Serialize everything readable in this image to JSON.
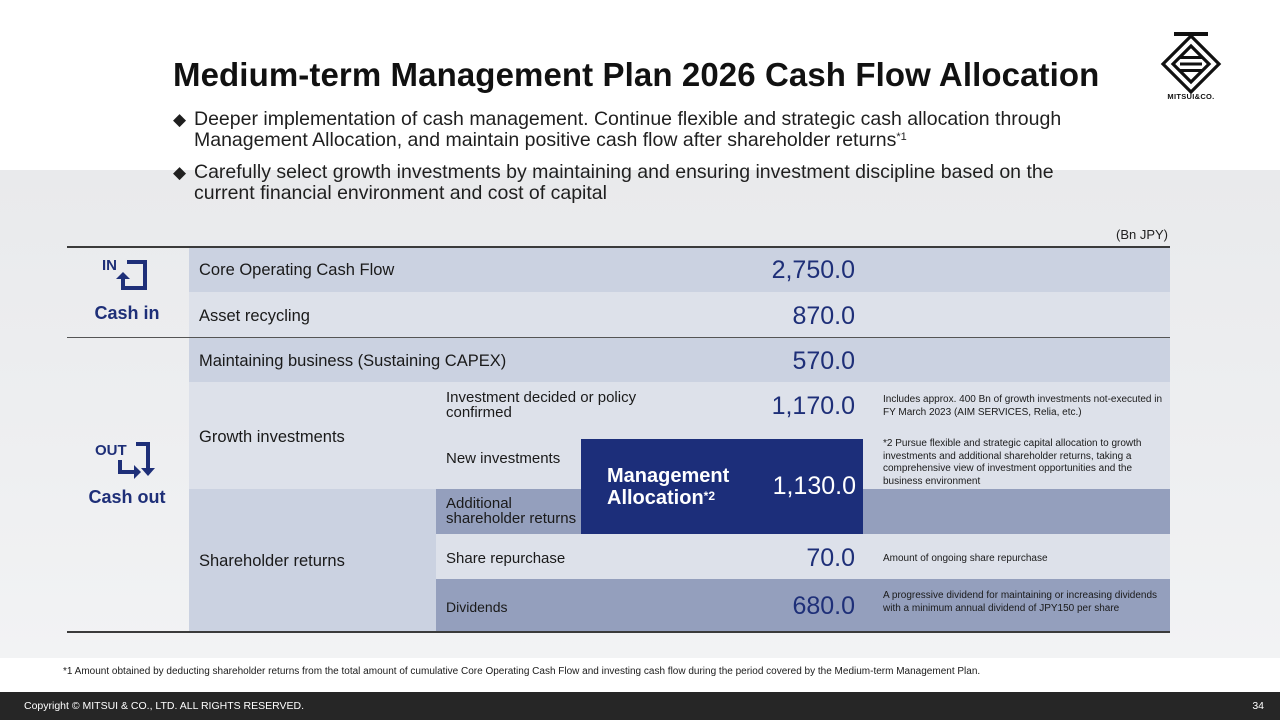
{
  "title": "Medium-term Management Plan 2026 Cash Flow Allocation",
  "logo": {
    "caption": "MITSUI&CO."
  },
  "bullets": [
    {
      "text": "Deeper implementation of cash management. Continue flexible and strategic cash allocation through Management Allocation, and maintain positive cash flow after shareholder returns",
      "sup": "*1"
    },
    {
      "text": "Carefully select growth investments by maintaining and ensuring investment discipline based on the current financial environment and cost of capital"
    }
  ],
  "unit": "(Bn JPY)",
  "cash_in": {
    "label": "Cash in",
    "icon_text": "IN",
    "rows": [
      {
        "label": "Core Operating Cash Flow",
        "value": "2,750.0"
      },
      {
        "label": "Asset recycling",
        "value": "870.0"
      }
    ]
  },
  "cash_out": {
    "label": "Cash out",
    "icon_text": "OUT",
    "maintaining": {
      "label": "Maintaining business (Sustaining CAPEX)",
      "value": "570.0"
    },
    "growth": {
      "label": "Growth investments",
      "decided": {
        "label": "Investment decided or policy confirmed",
        "value": "1,170.0",
        "note": "Includes approx. 400 Bn of growth investments not-executed in FY March 2023 (AIM SERVICES, Relia, etc.)"
      },
      "new": {
        "label": "New investments"
      }
    },
    "management_allocation": {
      "label_line1": "Management",
      "label_line2": "Allocation",
      "sup": "*2",
      "value": "1,130.0",
      "note": "*2 Pursue flexible and strategic capital allocation to growth investments and additional shareholder returns, taking a comprehensive view of investment opportunities and the business environment"
    },
    "shareholder": {
      "label": "Shareholder returns",
      "additional": {
        "label": "Additional shareholder returns"
      },
      "repurchase": {
        "label": "Share repurchase",
        "value": "70.0",
        "note": "Amount of ongoing share repurchase"
      },
      "dividends": {
        "label": "Dividends",
        "value": "680.0",
        "note": "A progressive dividend for maintaining or increasing dividends with a minimum annual dividend of JPY150 per share"
      }
    }
  },
  "footnote": "*1 Amount obtained by deducting shareholder returns from the total amount of cumulative Core Operating Cash Flow and investing cash flow during the period covered by the Medium-term Management Plan.",
  "footer": {
    "copyright": "Copyright © MITSUI & CO., LTD. ALL RIGHTS RESERVED.",
    "page": "34"
  },
  "colors": {
    "navy": "#1c2e7a",
    "light_band": "#cbd2e1",
    "dark_band": "#949fbd"
  }
}
